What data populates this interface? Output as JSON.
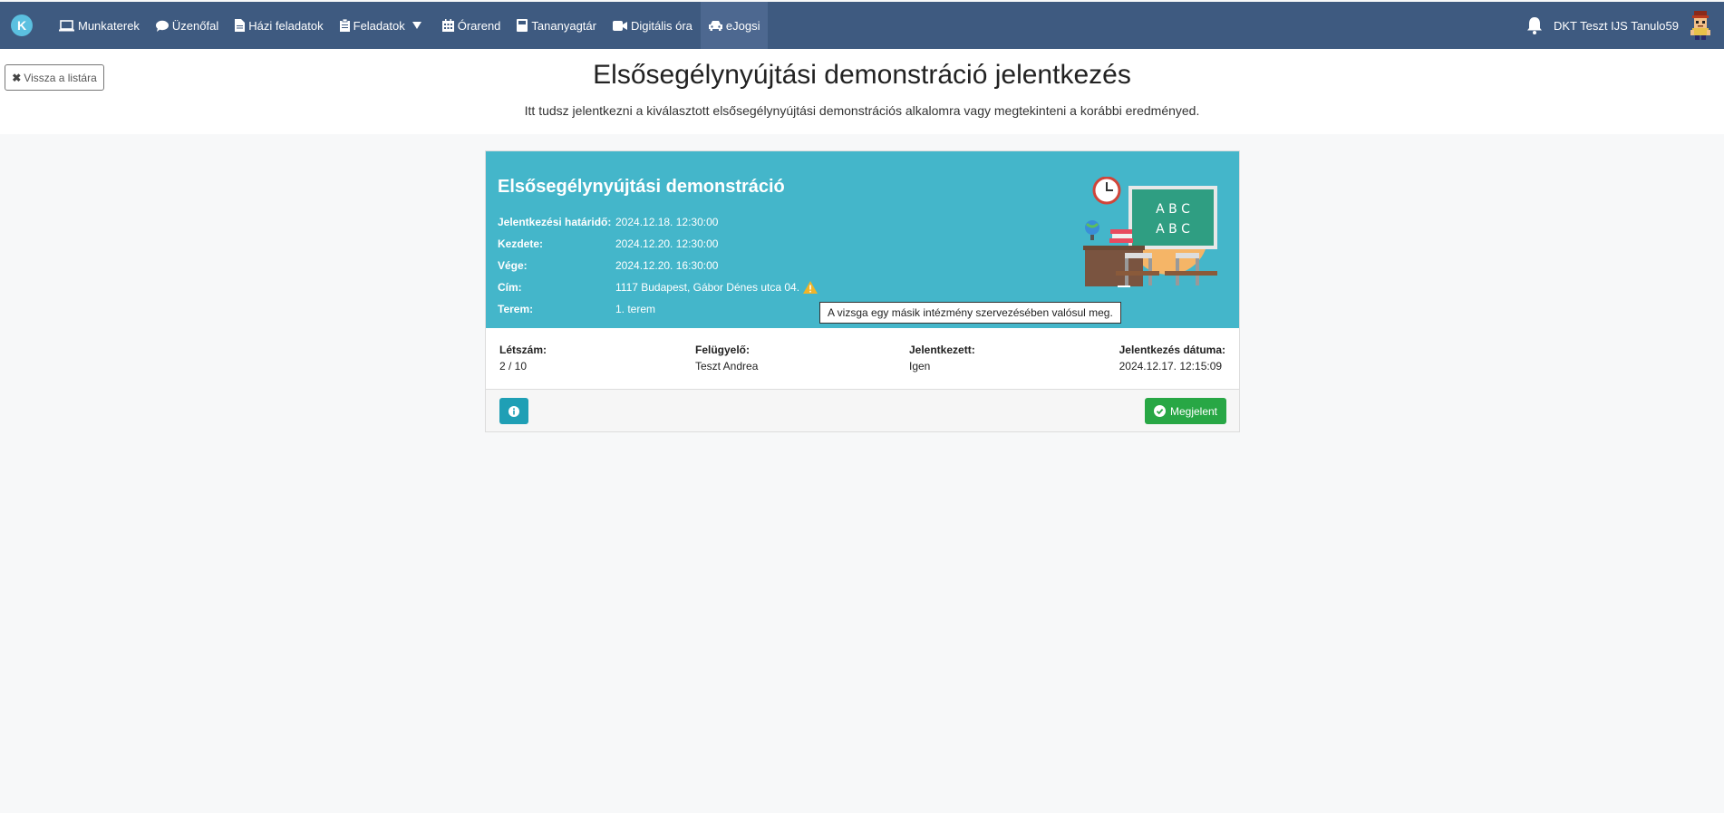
{
  "nav": {
    "items": [
      {
        "label": "Munkaterek",
        "icon": "laptop-icon"
      },
      {
        "label": "Üzenőfal",
        "icon": "chat-icon"
      },
      {
        "label": "Házi feladatok",
        "icon": "file-icon"
      },
      {
        "label": "Feladatok",
        "icon": "clipboard-icon"
      },
      {
        "label": "Órarend",
        "icon": "calendar-icon"
      },
      {
        "label": "Tananyagtár",
        "icon": "book-icon"
      },
      {
        "label": "Digitális óra",
        "icon": "video-icon"
      },
      {
        "label": "eJogsi",
        "icon": "car-icon"
      }
    ],
    "user": "DKT Teszt IJS Tanulo59",
    "colors": {
      "bar": "#3e5a80",
      "active": "#4d6890"
    }
  },
  "header": {
    "back_label": "Vissza a listára",
    "title": "Elsősegélynyújtási demonstráció jelentkezés",
    "subtitle": "Itt tudsz jelentkezni a kiválasztott elsősegélynyújtási demonstrációs alkalomra vagy megtekinteni a korábbi eredményed."
  },
  "card": {
    "title": "Elsősegélynyújtási demonstráció",
    "rows": [
      {
        "label": "Jelentkezési határidő:",
        "value": "2024.12.18. 12:30:00"
      },
      {
        "label": "Kezdete:",
        "value": "2024.12.20. 12:30:00"
      },
      {
        "label": "Vége:",
        "value": "2024.12.20. 16:30:00"
      },
      {
        "label": "Cím:",
        "value": "1117 Budapest, Gábor Dénes utca 04."
      },
      {
        "label": "Terem:",
        "value": "1. terem"
      }
    ],
    "tooltip": "A vizsga egy másik intézmény szervezésében valósul meg.",
    "stats": [
      {
        "label": "Létszám:",
        "value": "2 / 10"
      },
      {
        "label": "Felügyelő:",
        "value": "Teszt Andrea"
      },
      {
        "label": "Jelentkezett:",
        "value": "Igen"
      },
      {
        "label": "Jelentkezés dátuma:",
        "value": "2024.12.17. 12:15:09"
      }
    ],
    "status_button": "Megjelent",
    "illustration_text": [
      "A B C",
      "A B C"
    ],
    "colors": {
      "header": "#44b6ca",
      "ok": "#28a745",
      "info": "#1f9fb5"
    }
  }
}
